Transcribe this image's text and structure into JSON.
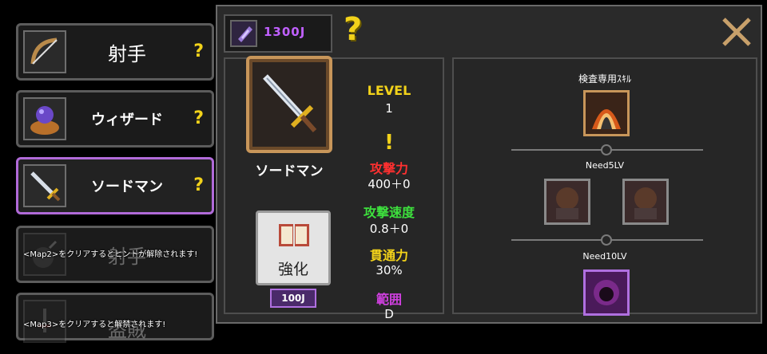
{
  "currency": {
    "icon": "crystal-icon",
    "value": "1300J"
  },
  "close_icon": "close-icon",
  "help_icon": "question-icon",
  "class_list": [
    {
      "name": "射手",
      "icon": "bow-icon",
      "state": "normal",
      "lock_text": ""
    },
    {
      "name": "ウィザード",
      "icon": "orb-icon",
      "state": "normal",
      "lock_text": ""
    },
    {
      "name": "ソードマン",
      "icon": "sword-icon",
      "state": "selected",
      "lock_text": ""
    },
    {
      "name": "射手",
      "icon": "bomb-icon",
      "state": "locked",
      "lock_text": "<Map2>をクリアするとヒントが解除されます!"
    },
    {
      "name": "盗賊",
      "icon": "dagger-icon",
      "state": "locked",
      "lock_text": "<Map3>をクリアすると解禁されます!"
    }
  ],
  "character": {
    "name": "ソードマン",
    "upgrade_label": "強化",
    "upgrade_cost": "100J"
  },
  "stats": {
    "level_label": "LEVEL",
    "level_value": "1",
    "alert": "!",
    "attack_label": "攻撃力",
    "attack_value": "400＋0",
    "speed_label": "攻撃速度",
    "speed_value": "0.8＋0",
    "pierce_label": "貫通力",
    "pierce_value": "30%",
    "range_label": "範囲",
    "range_value": "D"
  },
  "skills": {
    "title": "検査専用ｽｷﾙ",
    "tier1_req": "Need5LV",
    "tier2_req": "Need10LV"
  },
  "colors": {
    "level": "#f2d21a",
    "attack": "#ff3030",
    "speed": "#3de03d",
    "pierce": "#f2d21a",
    "range": "#d040e0",
    "currency": "#c060ff",
    "selected_border": "#b06ad8"
  }
}
